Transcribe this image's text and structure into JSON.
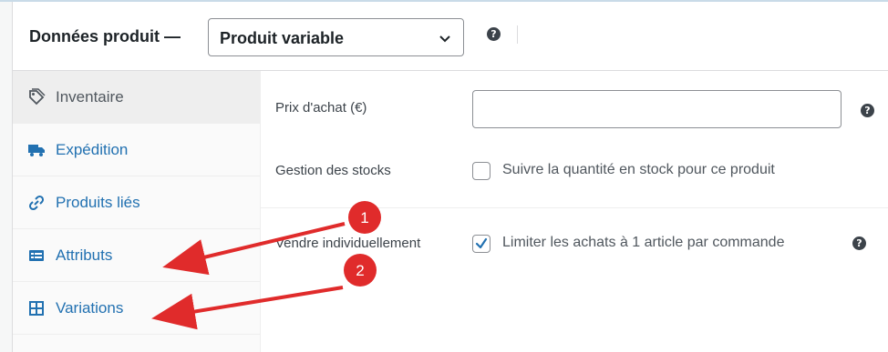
{
  "header": {
    "title": "Données produit —",
    "product_type": "Produit variable",
    "help_icon": "question-circle-icon"
  },
  "sidebar": {
    "tabs": [
      {
        "label": "Inventaire",
        "icon": "tag-icon",
        "active": true
      },
      {
        "label": "Expédition",
        "icon": "truck-icon",
        "active": false
      },
      {
        "label": "Produits liés",
        "icon": "link-icon",
        "active": false
      },
      {
        "label": "Attributs",
        "icon": "list-card-icon",
        "active": false
      },
      {
        "label": "Variations",
        "icon": "grid-icon",
        "active": false
      }
    ]
  },
  "inventory": {
    "purchase_price_label": "Prix d'achat (€)",
    "purchase_price_value": "",
    "stock_management_label": "Gestion des stocks",
    "stock_management_checkbox_label": "Suivre la quantité en stock pour ce produit",
    "stock_management_checked": false,
    "sold_individually_label": "Vendre individuellement",
    "sold_individually_checkbox_label": "Limiter les achats à 1 article par commande",
    "sold_individually_checked": true
  },
  "annotations": [
    {
      "number": "1",
      "color": "#e02b2b",
      "points_to": "Attributs"
    },
    {
      "number": "2",
      "color": "#e02b2b",
      "points_to": "Variations"
    }
  ],
  "colors": {
    "link": "#2271b1",
    "accent_annotation": "#e02b2b",
    "checkbox_check": "#2271b1"
  }
}
